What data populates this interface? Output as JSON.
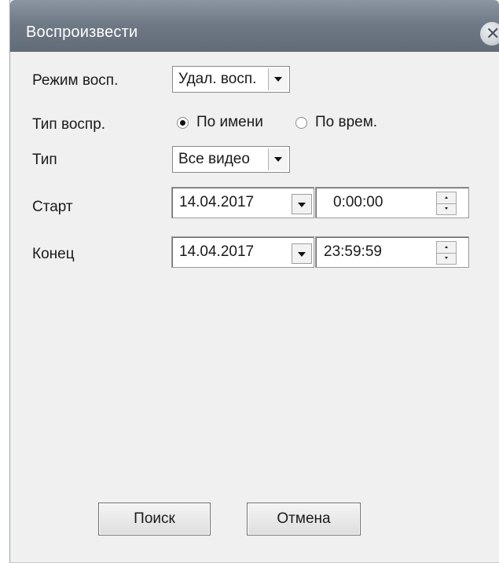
{
  "window": {
    "title": "Воспроизвести",
    "close_glyph": "✕"
  },
  "form": {
    "playback_mode": {
      "label": "Режим восп.",
      "value": "Удал. восп."
    },
    "playback_type": {
      "label": "Тип воспр.",
      "options": [
        {
          "label": "По имени",
          "selected": true
        },
        {
          "label": "По врем.",
          "selected": false
        }
      ]
    },
    "type": {
      "label": "Тип",
      "value": "Все видео"
    },
    "start": {
      "label": "Старт",
      "date": "14.04.2017",
      "time": "0:00:00"
    },
    "end": {
      "label": "Конец",
      "date": "14.04.2017",
      "time": "23:59:59"
    }
  },
  "buttons": {
    "search": "Поиск",
    "cancel": "Отмена"
  },
  "icons": {
    "close": "close-icon",
    "dropdown": "chevron-down-icon",
    "spin_up": "spin-up-icon",
    "spin_down": "spin-down-icon"
  }
}
